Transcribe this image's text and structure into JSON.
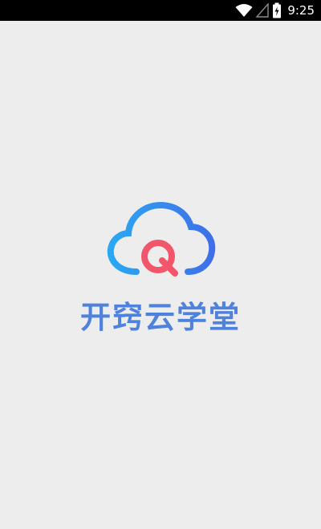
{
  "status_bar": {
    "time": "9:25",
    "icons": [
      "wifi-icon",
      "cellular-signal-icon",
      "battery-charging-icon"
    ]
  },
  "splash": {
    "app_name": "开窍云学堂",
    "logo": {
      "icon": "cloud-q-logo-icon",
      "letter": "Q"
    }
  },
  "colors": {
    "background": "#ededed",
    "status_bar": "#000000",
    "brand_blue": "#4f82dd",
    "cloud_gradient_start": "#2aa8f2",
    "cloud_gradient_end": "#3f6fe8",
    "logo_red": "#f2566a"
  }
}
